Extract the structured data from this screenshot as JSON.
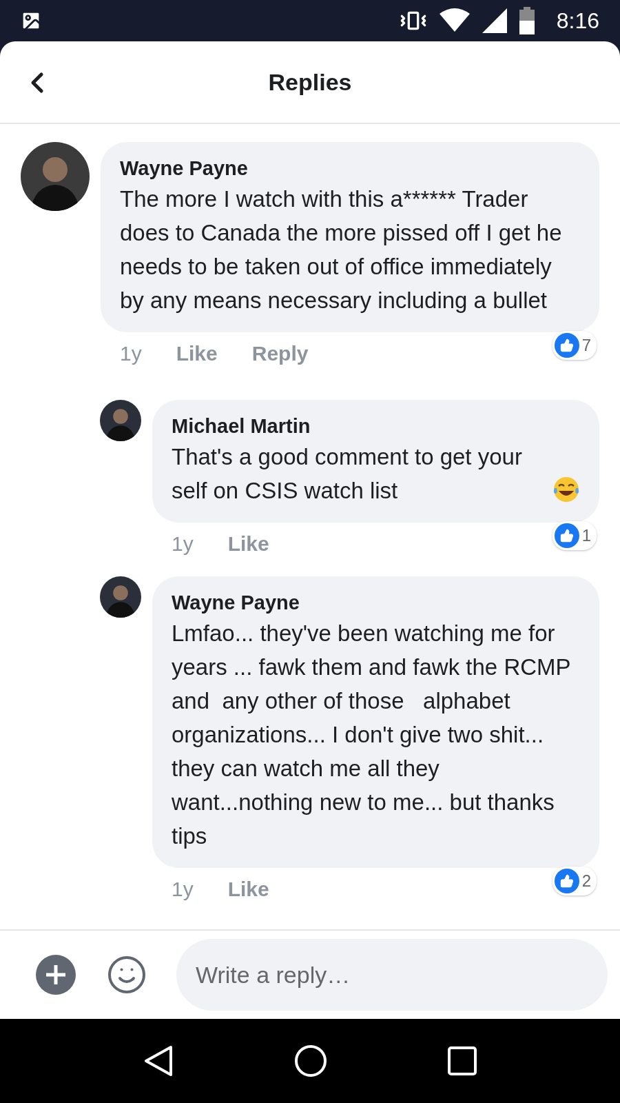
{
  "status_bar": {
    "time": "8:16"
  },
  "header": {
    "title": "Replies"
  },
  "comments": [
    {
      "author": "Wayne Payne",
      "text": "The more I watch with this a****** Trader does to Canada the more pissed off I get he needs to be taken out of office immediately by any means necessary including a bullet",
      "emoji": false,
      "time": "1y",
      "actions": [
        "Like",
        "Reply"
      ],
      "reactions": "7",
      "children": [
        {
          "author": "Michael Martin",
          "text": "That's a good comment to get your self on CSIS watch list",
          "emoji": true,
          "time": "1y",
          "actions": [
            "Like"
          ],
          "reactions": "1"
        },
        {
          "author": "Wayne Payne",
          "text": "Lmfao... they've been watching me for years ... fawk them and fawk the RCMP and  any other of those   alphabet organizations... I don't give two shit... they can watch me all they want...nothing new to me... but thanks tips",
          "emoji": false,
          "time": "1y",
          "actions": [
            "Like"
          ],
          "reactions": "2"
        }
      ]
    }
  ],
  "composer": {
    "placeholder": "Write a reply…"
  }
}
